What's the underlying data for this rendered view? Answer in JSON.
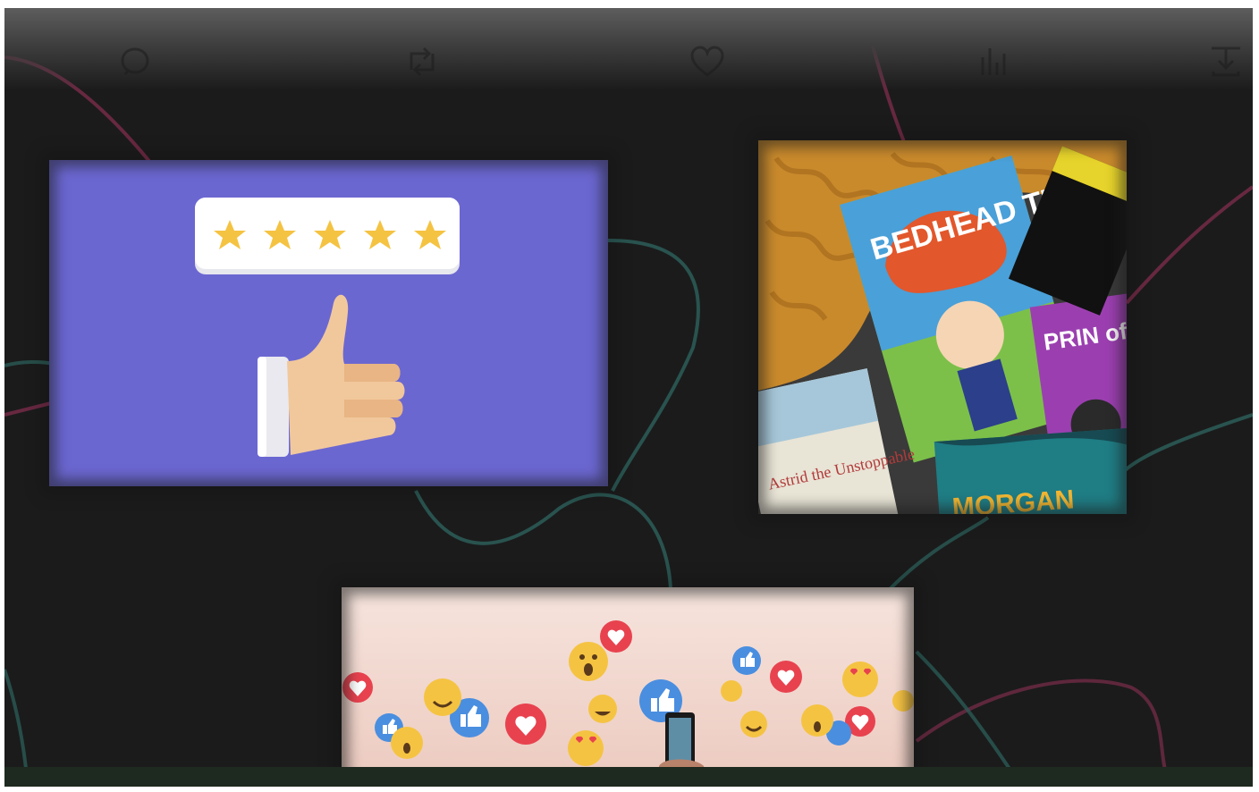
{
  "toolbar": {
    "buttons": [
      {
        "name": "reply-icon"
      },
      {
        "name": "repost-icon"
      },
      {
        "name": "like-icon"
      },
      {
        "name": "stats-icon"
      },
      {
        "name": "share-icon"
      }
    ]
  },
  "cards": {
    "rating": {
      "background": "#6b67d1",
      "stars": 5,
      "star_color": "#f5c342"
    },
    "books": {
      "titles": [
        "BEDHEAD TED",
        "PRIN of PE",
        "Astrid the Unstoppable",
        "MORGAN"
      ]
    },
    "reactions": {
      "background": "#f4d9cf"
    }
  },
  "colors": {
    "frame_bg": "#1b1b1b",
    "line_pink": "#7a2c4a",
    "line_teal": "#2b5a55",
    "bottom_bar": "#1e2a1f"
  }
}
